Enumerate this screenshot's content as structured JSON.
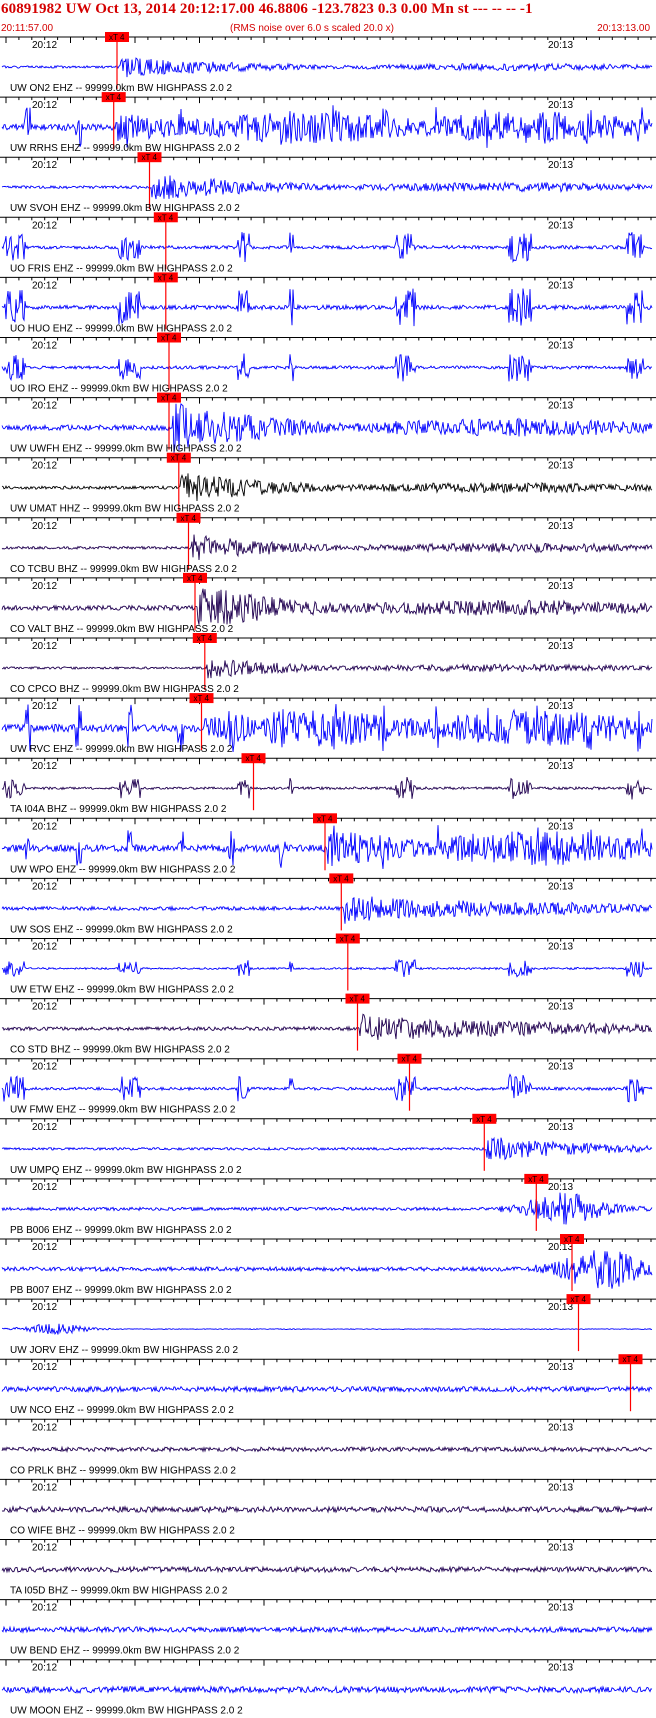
{
  "header": {
    "title": "60891982 UW Oct 13, 2014 20:12:17.00   46.8806 -123.7823  0.3 0.00 Mn st --- -- --  -1",
    "start_time": "20:11:57.00",
    "rms_note": "(RMS noise over 6.0 s scaled 20.0 x)",
    "end_time": "20:13:13.00"
  },
  "time_labels": {
    "left": "20:12",
    "right": "20:13"
  },
  "pick_label": "xT 4",
  "colors": {
    "header": "#d40000",
    "pick": "#ff0000",
    "blue": "#0000ff",
    "dark": "#200050",
    "black": "#000000",
    "axis": "#000000"
  },
  "traces": [
    {
      "label": "UW ON2 EHZ -- 99999.0km BW  HIGHPASS  2.0  2",
      "color": "blue",
      "pick": 0.18,
      "amp": 0.35,
      "seed": 1,
      "style": "emergent"
    },
    {
      "label": "UW RRHS EHZ -- 99999.0km BW  HIGHPASS  2.0  2",
      "color": "blue",
      "pick": 0.175,
      "amp": 0.85,
      "seed": 2,
      "style": "burst"
    },
    {
      "label": "UW SVOH EHZ -- 99999.0km BW  HIGHPASS  2.0  2",
      "color": "blue",
      "pick": 0.23,
      "amp": 0.45,
      "seed": 3,
      "style": "emergent"
    },
    {
      "label": "UO FRIS EHZ -- 99999.0km BW  HIGHPASS  2.0  2",
      "color": "blue",
      "pick": 0.255,
      "amp": 0.6,
      "seed": 4,
      "style": "spiky"
    },
    {
      "label": "UO HUO EHZ -- 99999.0km BW  HIGHPASS  2.0  2",
      "color": "blue",
      "pick": 0.255,
      "amp": 0.75,
      "seed": 5,
      "style": "spiky"
    },
    {
      "label": "UO IRO EHZ -- 99999.0km BW  HIGHPASS  2.0  2",
      "color": "blue",
      "pick": 0.26,
      "amp": 0.55,
      "seed": 6,
      "style": "spiky"
    },
    {
      "label": "UW UWFH EHZ -- 99999.0km BW  HIGHPASS  2.0  2",
      "color": "blue",
      "pick": 0.26,
      "amp": 0.85,
      "seed": 7,
      "style": "emergent"
    },
    {
      "label": "UW UMAT HHZ -- 99999.0km BW  HIGHPASS  2.0  2",
      "color": "black",
      "pick": 0.275,
      "amp": 0.5,
      "seed": 8,
      "style": "quake"
    },
    {
      "label": "CO TCBU BHZ -- 99999.0km BW  HIGHPASS  2.0  2",
      "color": "dark",
      "pick": 0.29,
      "amp": 0.45,
      "seed": 9,
      "style": "quake"
    },
    {
      "label": "CO VALT BHZ -- 99999.0km BW  HIGHPASS  2.0  2",
      "color": "dark",
      "pick": 0.3,
      "amp": 0.75,
      "seed": 10,
      "style": "quake"
    },
    {
      "label": "CO CPCO BHZ -- 99999.0km BW  HIGHPASS  2.0  2",
      "color": "dark",
      "pick": 0.315,
      "amp": 0.35,
      "seed": 11,
      "style": "quake"
    },
    {
      "label": "UW RVC EHZ -- 99999.0km BW  HIGHPASS  2.0  2",
      "color": "blue",
      "pick": 0.31,
      "amp": 0.95,
      "seed": 12,
      "style": "burst"
    },
    {
      "label": "TA I04A BHZ -- 99999.0km BW  HIGHPASS  2.0  2",
      "color": "dark",
      "pick": 0.39,
      "amp": 0.45,
      "seed": 13,
      "style": "spiky"
    },
    {
      "label": "UW WPO EHZ -- 99999.0km BW  HIGHPASS  2.0  2",
      "color": "blue",
      "pick": 0.5,
      "amp": 0.9,
      "seed": 14,
      "style": "burst"
    },
    {
      "label": "UW SOS EHZ -- 99999.0km BW  HIGHPASS  2.0  2",
      "color": "blue",
      "pick": 0.525,
      "amp": 0.6,
      "seed": 15,
      "style": "quake"
    },
    {
      "label": "UW ETW EHZ -- 99999.0km BW  HIGHPASS  2.0  2",
      "color": "blue",
      "pick": 0.535,
      "amp": 0.35,
      "seed": 16,
      "style": "spiky"
    },
    {
      "label": "CO STD BHZ -- 99999.0km BW  HIGHPASS  2.0  2",
      "color": "dark",
      "pick": 0.55,
      "amp": 0.6,
      "seed": 17,
      "style": "quake"
    },
    {
      "label": "UW FMW EHZ -- 99999.0km BW  HIGHPASS  2.0  2",
      "color": "blue",
      "pick": 0.63,
      "amp": 0.55,
      "seed": 18,
      "style": "spiky"
    },
    {
      "label": "UW UMPQ EHZ -- 99999.0km BW  HIGHPASS  2.0  2",
      "color": "blue",
      "pick": 0.745,
      "amp": 0.4,
      "seed": 19,
      "style": "quake"
    },
    {
      "label": "PB B006 EHZ -- 99999.0km BW  HIGHPASS  2.0  2",
      "color": "blue",
      "pick": 0.825,
      "amp": 0.6,
      "seed": 20,
      "style": "late"
    },
    {
      "label": "PB B007 EHZ -- 99999.0km BW  HIGHPASS  2.0  2",
      "color": "blue",
      "pick": 0.88,
      "amp": 0.8,
      "seed": 21,
      "style": "late"
    },
    {
      "label": "UW JORV EHZ -- 99999.0km BW  HIGHPASS  2.0  2",
      "color": "blue",
      "pick": 0.89,
      "amp": 0.25,
      "seed": 22,
      "style": "early"
    },
    {
      "label": "UW NCO EHZ -- 99999.0km BW  HIGHPASS  2.0  2",
      "color": "blue",
      "pick": 0.97,
      "amp": 0.18,
      "seed": 23,
      "style": "noise"
    },
    {
      "label": "CO PRLK BHZ -- 99999.0km BW  HIGHPASS  2.0  2",
      "color": "dark",
      "pick": null,
      "amp": 0.15,
      "seed": 24,
      "style": "noise"
    },
    {
      "label": "CO WIFE BHZ -- 99999.0km BW  HIGHPASS  2.0  2",
      "color": "dark",
      "pick": null,
      "amp": 0.2,
      "seed": 25,
      "style": "noise"
    },
    {
      "label": "TA I05D BHZ -- 99999.0km BW  HIGHPASS  2.0  2",
      "color": "dark",
      "pick": null,
      "amp": 0.18,
      "seed": 26,
      "style": "noise"
    },
    {
      "label": "UW BEND EHZ -- 99999.0km BW  HIGHPASS  2.0  2",
      "color": "blue",
      "pick": null,
      "amp": 0.18,
      "seed": 27,
      "style": "noise"
    },
    {
      "label": "UW MOON EHZ -- 99999.0km BW  HIGHPASS  2.0  2",
      "color": "blue",
      "pick": null,
      "amp": 0.22,
      "seed": 28,
      "style": "noise"
    }
  ]
}
